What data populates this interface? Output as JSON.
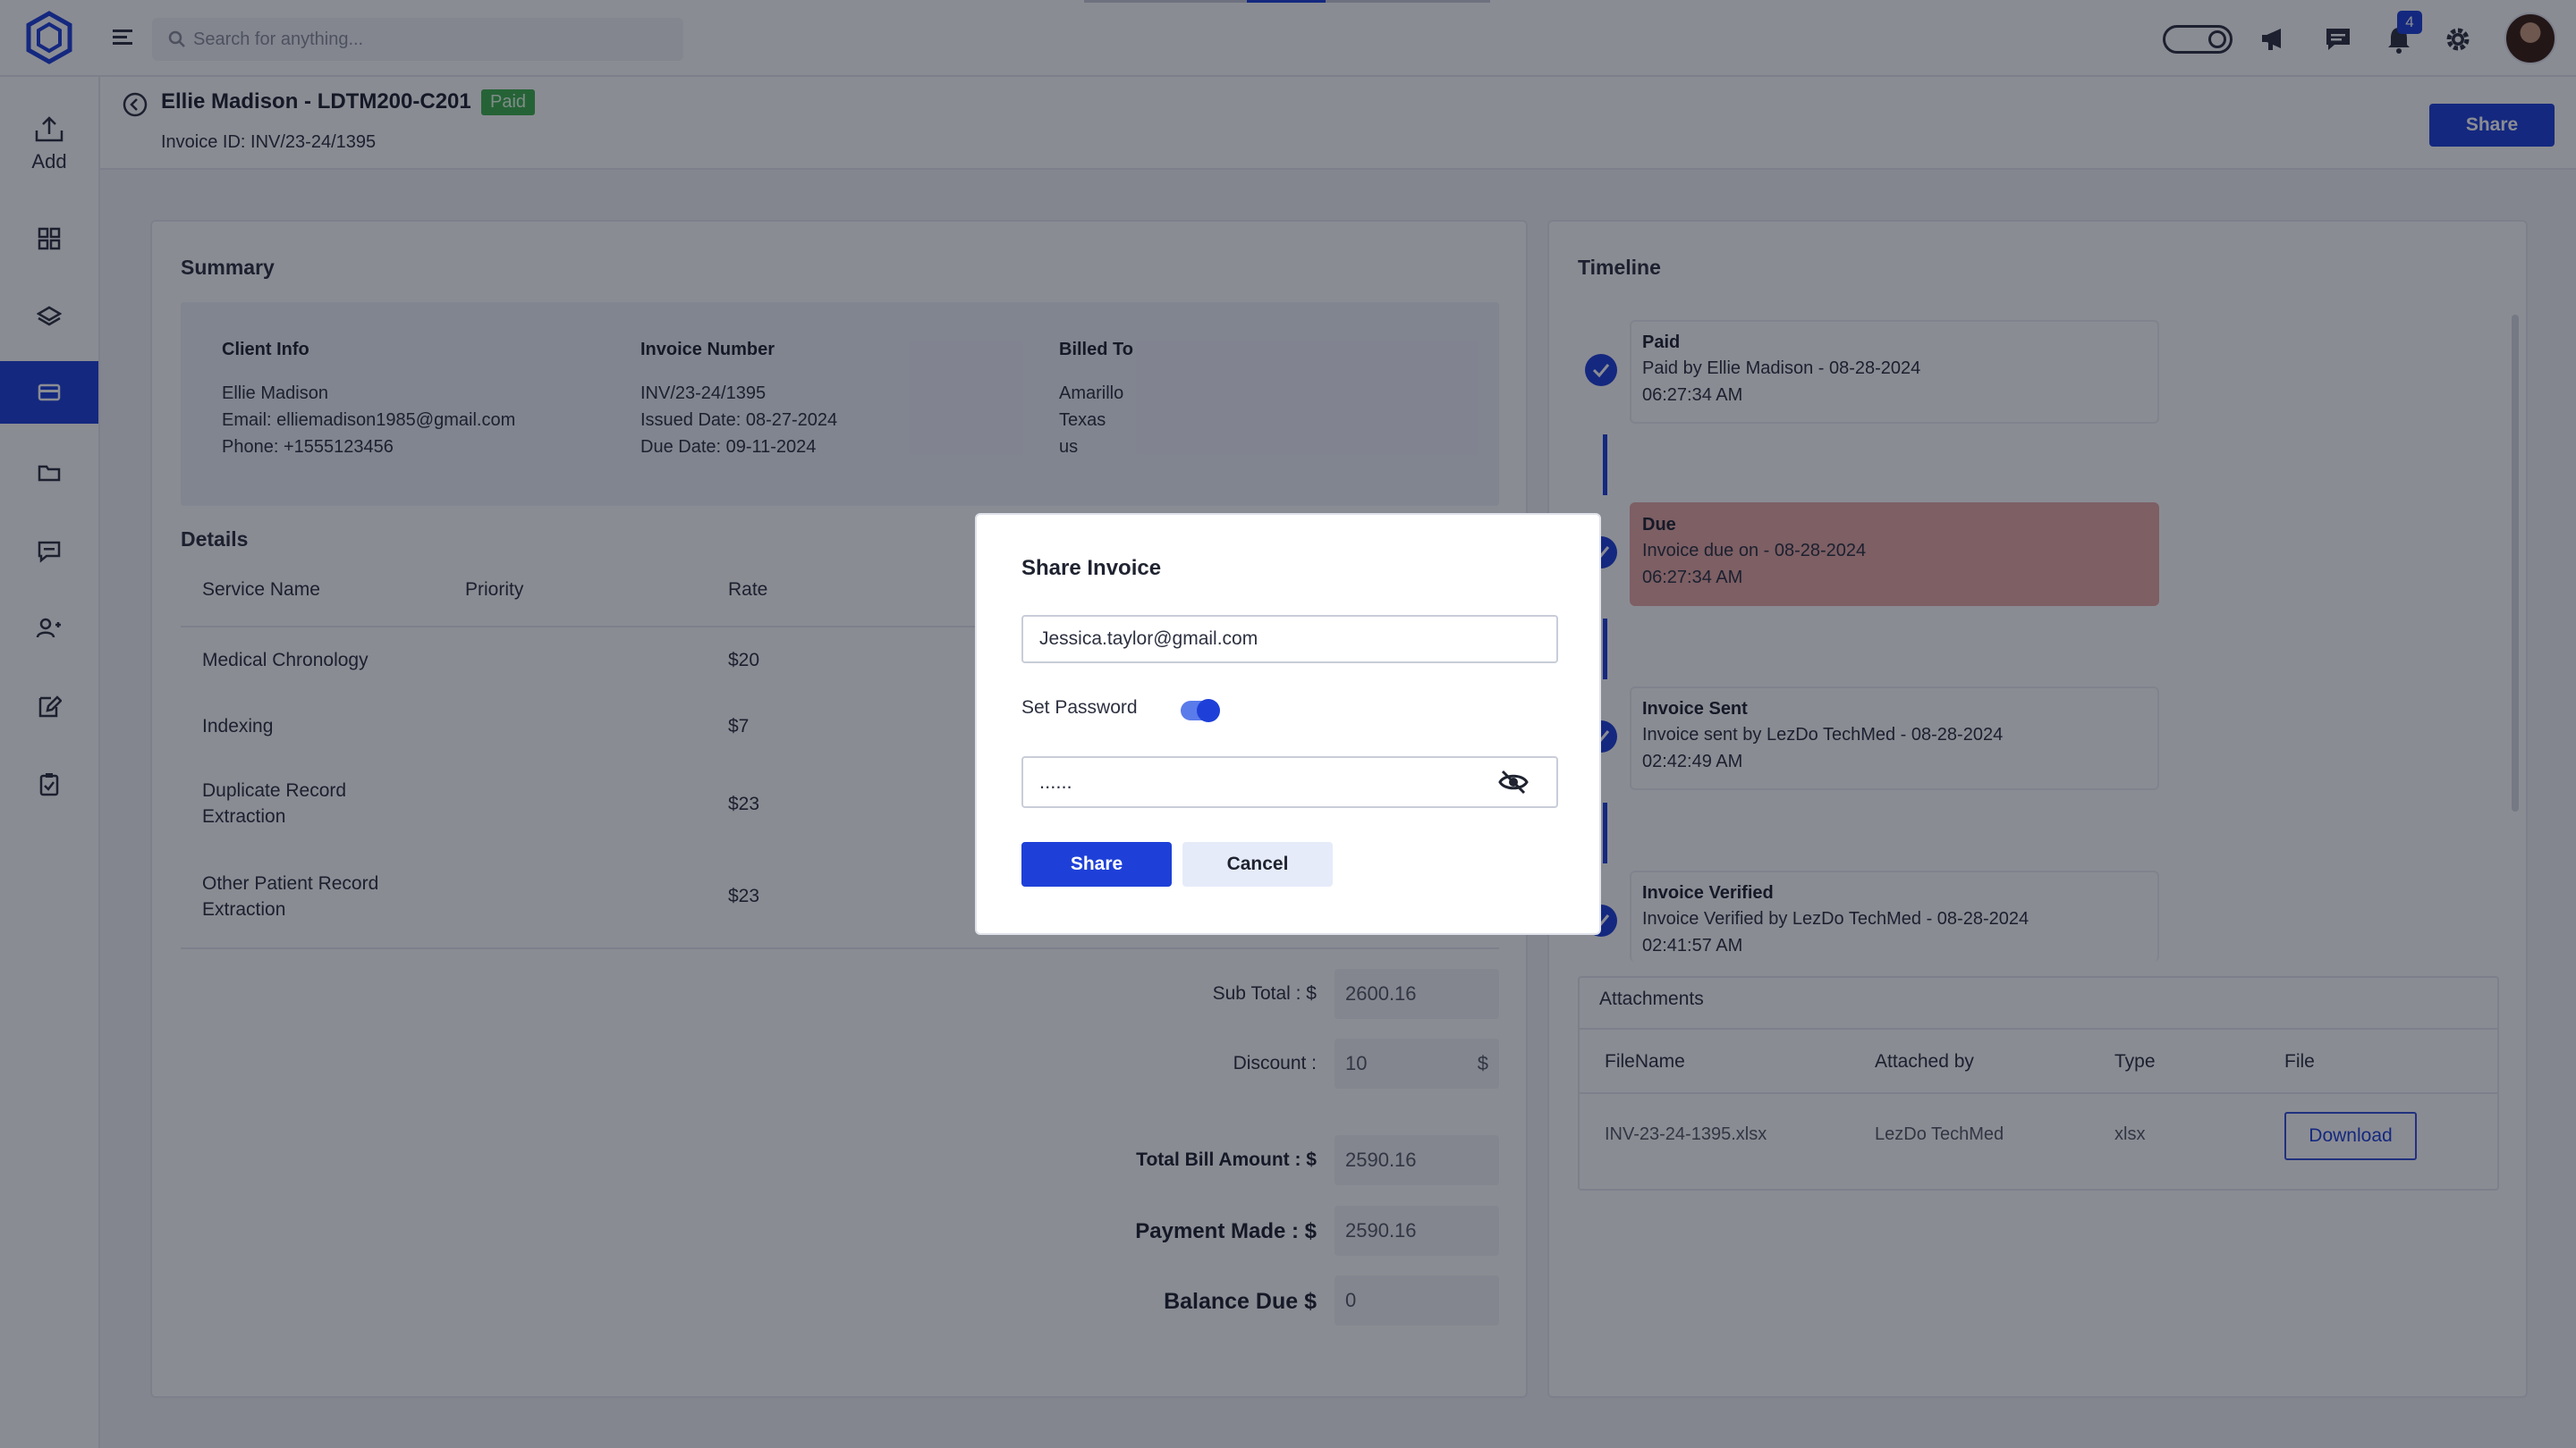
{
  "topbar": {
    "search_placeholder": "Search for anything...",
    "notifications_count": "4"
  },
  "sidebar": {
    "add_label": "Add"
  },
  "header": {
    "title": "Ellie Madison - LDTM200-C201",
    "status_badge": "Paid",
    "invoice_id": "Invoice ID: INV/23-24/1395",
    "share_label": "Share"
  },
  "summary": {
    "title": "Summary",
    "client_info": {
      "heading": "Client Info",
      "name": "Ellie Madison",
      "email": "Email: elliemadison1985@gmail.com",
      "phone": "Phone: +1555123456"
    },
    "invoice_number": {
      "heading": "Invoice Number",
      "number": "INV/23-24/1395",
      "issued": "Issued Date: 08-27-2024",
      "due": "Due Date: 09-11-2024"
    },
    "billed_to": {
      "heading": "Billed To",
      "city": "Amarillo",
      "state": "Texas",
      "country": "us"
    }
  },
  "details": {
    "title": "Details",
    "columns": [
      "Service Name",
      "Priority",
      "Rate"
    ],
    "rows": [
      {
        "service_line1": "Medical Chronology",
        "service_line2": "",
        "priority": "",
        "rate": "$20"
      },
      {
        "service_line1": "Indexing",
        "service_line2": "",
        "priority": "",
        "rate": "$7"
      },
      {
        "service_line1": "Duplicate Record",
        "service_line2": "Extraction",
        "priority": "",
        "rate": "$23"
      },
      {
        "service_line1": "Other Patient Record",
        "service_line2": "Extraction",
        "priority": "",
        "rate": "$23"
      }
    ]
  },
  "totals": {
    "subtotal_label": "Sub Total : $",
    "subtotal_value": "2600.16",
    "discount_label": "Discount :",
    "discount_value": "10",
    "discount_unit": "$",
    "total_label": "Total Bill Amount : $",
    "total_value": "2590.16",
    "payment_label": "Payment Made : $",
    "payment_value": "2590.16",
    "balance_label": "Balance Due $",
    "balance_value": "0"
  },
  "timeline": {
    "title": "Timeline",
    "items": [
      {
        "title": "Paid",
        "desc": "Paid by Ellie Madison - 08-28-2024",
        "time": "06:27:34 AM"
      },
      {
        "title": "Due",
        "desc": "Invoice due on - 08-28-2024",
        "time": "06:27:34 AM"
      },
      {
        "title": "Invoice Sent",
        "desc": "Invoice sent by LezDo TechMed - 08-28-2024",
        "time": "02:42:49 AM"
      },
      {
        "title": "Invoice Verified",
        "desc": "Invoice Verified by LezDo TechMed - 08-28-2024",
        "time": "02:41:57 AM"
      }
    ]
  },
  "attachments": {
    "title": "Attachments",
    "columns": [
      "FileName",
      "Attached by",
      "Type",
      "File"
    ],
    "rows": [
      {
        "filename": "INV-23-24-1395.xlsx",
        "attached_by": "LezDo TechMed",
        "type": "xlsx",
        "action": "Download"
      }
    ]
  },
  "modal": {
    "title": "Share Invoice",
    "email_value": "Jessica.taylor@gmail.com",
    "set_password_label": "Set Password",
    "set_password_enabled": true,
    "password_masked": "......",
    "share_label": "Share",
    "cancel_label": "Cancel"
  },
  "colors": {
    "accent": "#1e40d8",
    "paid_badge": "#3fb04e",
    "due_highlight": "#e7a9a6"
  },
  "icons": [
    "logo-icon",
    "menu-icon",
    "search-icon",
    "theme-toggle-icon",
    "megaphone-icon",
    "chat-icon",
    "bell-icon",
    "gear-icon",
    "upload-icon",
    "dashboard-icon",
    "layers-icon",
    "card-icon",
    "folder-icon",
    "message-icon",
    "users-icon",
    "edit-icon",
    "clipboard-icon",
    "back-icon",
    "check-icon",
    "eye-off-icon"
  ]
}
